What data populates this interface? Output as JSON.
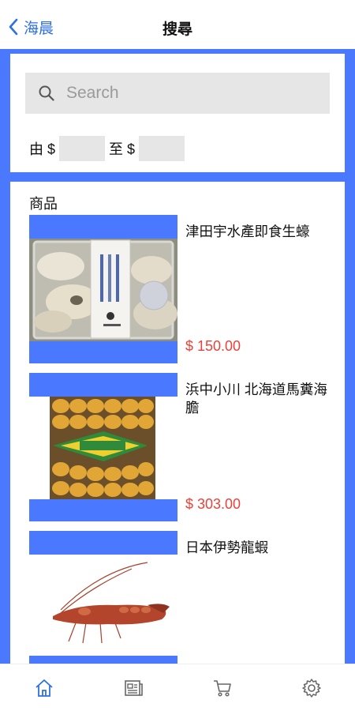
{
  "nav": {
    "back_label": "海晨",
    "title": "搜尋"
  },
  "search": {
    "placeholder": "Search",
    "from_label": "由 $",
    "to_label": "至 $"
  },
  "products": {
    "section_title": "商品",
    "items": [
      {
        "name": "津田宇水產即食生蠔",
        "price": "$ 150.00"
      },
      {
        "name": "浜中小川 北海道馬糞海膽",
        "price": "$ 303.00"
      },
      {
        "name": "日本伊勢龍蝦",
        "price": ""
      }
    ]
  },
  "tabbar": {
    "items": [
      {
        "icon": "home-icon",
        "active": true
      },
      {
        "icon": "news-icon",
        "active": false
      },
      {
        "icon": "cart-icon",
        "active": false
      },
      {
        "icon": "gear-icon",
        "active": false
      }
    ]
  },
  "colors": {
    "accent": "#2f6fe4",
    "frame": "#4a78ff",
    "price": "#e8433a",
    "input_bg": "#e6e6e6"
  }
}
